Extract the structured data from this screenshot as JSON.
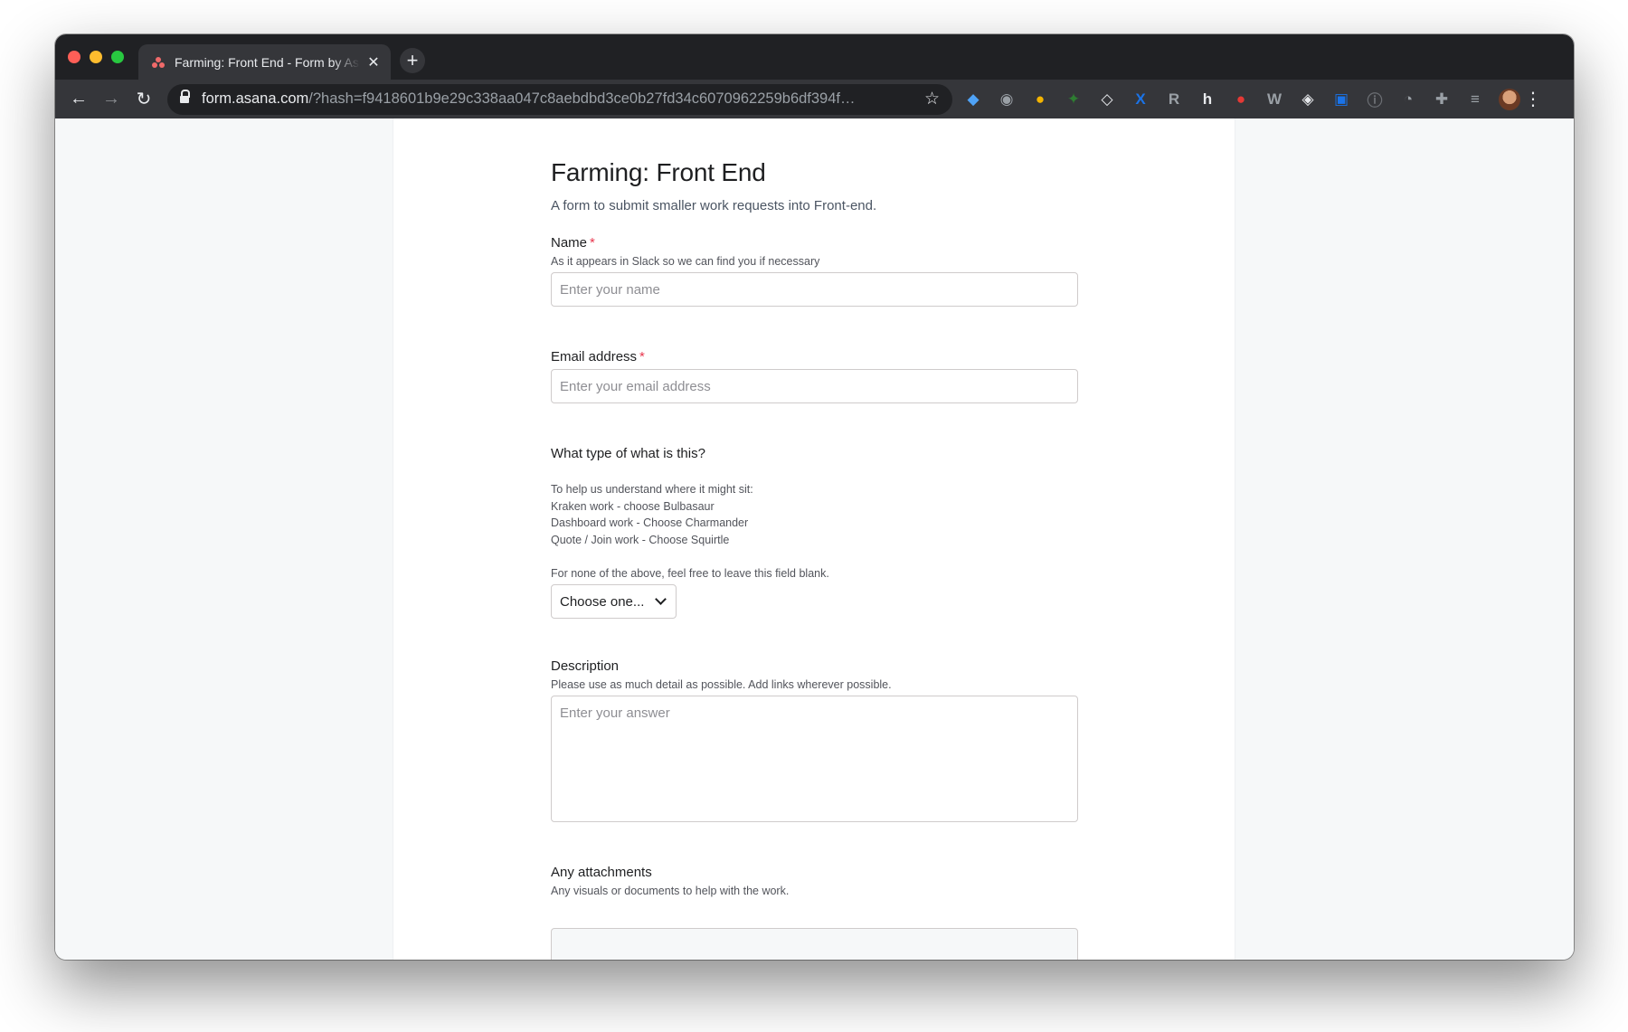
{
  "browser": {
    "tab_title": "Farming: Front End - Form by Asana",
    "tab_close": "✕",
    "new_tab": "+",
    "url_domain": "form.asana.com",
    "url_path": "/?hash=f9418601b9e29c338aa047c8aebdbd3ce0b27fd34c6070962259b6df394f…",
    "nav_back": "←",
    "nav_forward": "→",
    "nav_reload": "↻",
    "star": "☆",
    "menu": "⋮",
    "extensions": [
      {
        "name": "sketch-extension-icon",
        "glyph": "◆",
        "color": "#4fa3f7"
      },
      {
        "name": "camera-extension-icon",
        "glyph": "◉",
        "color": "#9aa0a6"
      },
      {
        "name": "color-picker-extension-icon",
        "glyph": "●",
        "color": "#f4b400"
      },
      {
        "name": "leaf-extension-icon",
        "glyph": "✦",
        "color": "#2e7d32"
      },
      {
        "name": "eraser-extension-icon",
        "glyph": "◇",
        "color": "#e8eaed"
      },
      {
        "name": "translate-extension-icon",
        "glyph": "X",
        "color": "#1a73e8"
      },
      {
        "name": "reader-extension-icon",
        "glyph": "R",
        "color": "#9aa0a6"
      },
      {
        "name": "honey-extension-icon",
        "glyph": "h",
        "color": "#e8eaed"
      },
      {
        "name": "pocket-extension-icon",
        "glyph": "●",
        "color": "#e53935"
      },
      {
        "name": "wordtune-extension-icon",
        "glyph": "W",
        "color": "#9aa0a6"
      },
      {
        "name": "code-extension-icon",
        "glyph": "◈",
        "color": "#e8eaed"
      },
      {
        "name": "tabs-extension-icon",
        "glyph": "▣",
        "color": "#1a73e8"
      },
      {
        "name": "info-extension-icon",
        "glyph": "ⓘ",
        "color": "#6b6e73"
      },
      {
        "name": "chat-extension-icon",
        "glyph": "◔",
        "color": "#9aa0a6"
      },
      {
        "name": "puzzle-extensions-icon",
        "glyph": "✚",
        "color": "#9aa0a6"
      },
      {
        "name": "reading-list-icon",
        "glyph": "≡",
        "color": "#9aa0a6"
      }
    ]
  },
  "form": {
    "title": "Farming: Front End",
    "description": "A form to submit smaller work requests into Front-end.",
    "required_mark": "*",
    "name": {
      "label": "Name",
      "help": "As it appears in Slack so we can find you if necessary",
      "placeholder": "Enter your name",
      "value": ""
    },
    "email": {
      "label": "Email address",
      "placeholder": "Enter your email address",
      "value": ""
    },
    "type": {
      "label": "What type of what is this?",
      "help_lines": [
        "To help us understand where it might sit:",
        "Kraken work - choose Bulbasaur",
        "Dashboard work - Choose Charmander",
        "Quote / Join work - Choose Squirtle"
      ],
      "help_footer": "For none of the above, feel free to leave this field blank.",
      "selected": "Choose one..."
    },
    "description_field": {
      "label": "Description",
      "help": "Please use as much detail as possible. Add links wherever possible.",
      "placeholder": "Enter your answer",
      "value": ""
    },
    "attachments": {
      "label": "Any attachments",
      "help": "Any visuals or documents to help with the work."
    }
  }
}
